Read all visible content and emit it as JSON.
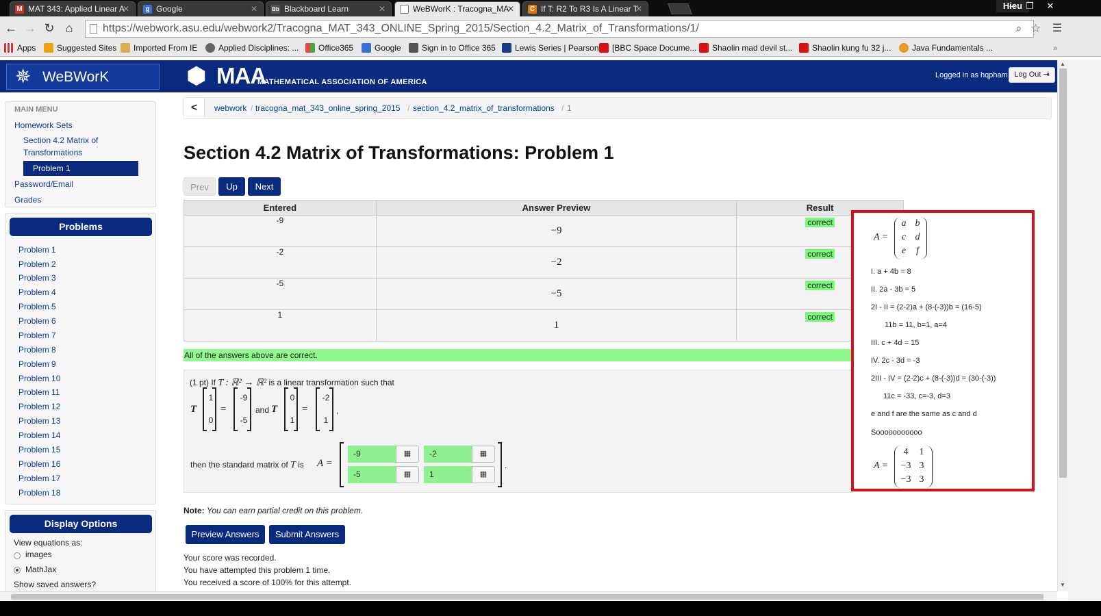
{
  "browser": {
    "tabs": [
      {
        "label": "MAT 343: Applied Linear A",
        "favicon": "M",
        "color": "#c8332b"
      },
      {
        "label": "Google",
        "favicon": "g",
        "color": "#3a6fd8"
      },
      {
        "label": "Blackboard Learn",
        "favicon": "Bb",
        "color": "#555"
      },
      {
        "label": "WeBWorK : Tracogna_MA",
        "favicon": "",
        "color": "#fff"
      },
      {
        "label": "If T: R2 To R3 Is A Linear T",
        "favicon": "C",
        "color": "#e07810"
      }
    ],
    "user_name": "Hieu",
    "url": "https://webwork.asu.edu/webwork2/Tracogna_MAT_343_ONLINE_Spring_2015/Section_4.2_Matrix_of_Transformations/1/",
    "bookmarks": [
      "Apps",
      "Suggested Sites",
      "Imported From IE",
      "Applied Disciplines: ...",
      "Office365",
      "Google",
      "Sign in to Office 365",
      "Lewis Series | Pearson",
      "[BBC Space Docume...",
      "Shaolin mad devil st...",
      "Shaolin kung fu 32 j...",
      "Java Fundamentals ..."
    ]
  },
  "header": {
    "logo_text": "WeBWorK",
    "maa_big": "MAA",
    "maa_small": "MATHEMATICAL ASSOCIATION OF AMERICA",
    "logged_in": "Logged in as hqpham.",
    "logout": "Log Out"
  },
  "main_menu": {
    "title": "MAIN MENU",
    "homework_sets": "Homework Sets",
    "section_line1": "Section 4.2 Matrix of",
    "section_line2": "Transformations",
    "active_problem": "Problem 1",
    "password_email": "Password/Email",
    "grades": "Grades"
  },
  "problems_panel": {
    "title": "Problems",
    "items": [
      "Problem 1",
      "Problem 2",
      "Problem 3",
      "Problem 4",
      "Problem 5",
      "Problem 6",
      "Problem 7",
      "Problem 8",
      "Problem 9",
      "Problem 10",
      "Problem 11",
      "Problem 12",
      "Problem 13",
      "Problem 14",
      "Problem 15",
      "Problem 16",
      "Problem 17",
      "Problem 18"
    ]
  },
  "display_options": {
    "title": "Display Options",
    "view_as": "View equations as:",
    "opt_images": "images",
    "opt_mathjax": "MathJax",
    "show_saved": "Show saved answers?"
  },
  "breadcrumb": {
    "back": "<",
    "items": [
      "webwork",
      "tracogna_mat_343_online_spring_2015",
      "section_4.2_matrix_of_transformations",
      "1"
    ]
  },
  "page_title": "Section 4.2 Matrix of Transformations: Problem 1",
  "nav_buttons": {
    "prev": "Prev",
    "up": "Up",
    "next": "Next"
  },
  "results": {
    "headers": [
      "Entered",
      "Answer Preview",
      "Result"
    ],
    "rows": [
      {
        "entered": "-9",
        "preview": "−9",
        "result": "correct"
      },
      {
        "entered": "-2",
        "preview": "−2",
        "result": "correct"
      },
      {
        "entered": "-5",
        "preview": "−5",
        "result": "correct"
      },
      {
        "entered": "1",
        "preview": "1",
        "result": "correct"
      }
    ],
    "summary": "All of the answers above are correct."
  },
  "problem": {
    "intro_pts": "(1 pt) If",
    "intro_map": "T : ℝ² → ℝ²",
    "intro_rest": "is a linear transformation such that",
    "T": "T",
    "eq": "=",
    "and": "and",
    "comma": ",",
    "v1": [
      "1",
      "0"
    ],
    "img1": [
      "-9",
      "-5"
    ],
    "v2": [
      "0",
      "1"
    ],
    "img2": [
      "-2",
      "1"
    ],
    "then_text": "then the standard matrix of",
    "is_text": "is",
    "A_eq": "A =",
    "period": ".",
    "answers": [
      "-9",
      "-2",
      "-5",
      "1"
    ]
  },
  "note_label": "Note:",
  "note_text": "You can earn partial credit on this problem.",
  "buttons": {
    "preview": "Preview Answers",
    "submit": "Submit Answers"
  },
  "messages": [
    "Your score was recorded.",
    "You have attempted this problem 1 time.",
    "You received a score of 100% for this attempt."
  ],
  "annotation": {
    "A_label": "A =",
    "top_matrix": [
      [
        "a",
        "b"
      ],
      [
        "c",
        "d"
      ],
      [
        "e",
        "f"
      ]
    ],
    "lines": [
      "I. a + 4b = 8",
      "II. 2a - 3b = 5",
      "2I - II = (2-2)a + (8-(-3))b = (16-5)",
      "11b = 11, b=1, a=4",
      "III. c + 4d = 15",
      "IV. 2c - 3d = -3",
      "2III - IV = (2-2)c + (8-(-3))d = (30-(-3))",
      "11c = -33, c=-3, d=3",
      "e and f are the same as c and d",
      "Sooooooooooo"
    ],
    "result_matrix": [
      [
        "4",
        "1"
      ],
      [
        "−3",
        "3"
      ],
      [
        "−3",
        "3"
      ]
    ]
  },
  "colors": {
    "navy": "#0a2a80",
    "correct_green": "#7af87a",
    "annotation_red": "#d8101e"
  }
}
